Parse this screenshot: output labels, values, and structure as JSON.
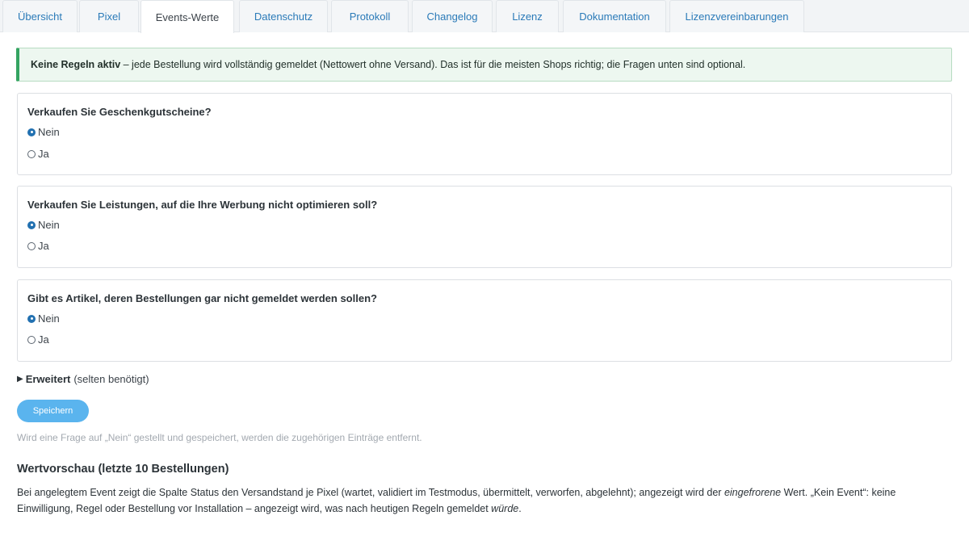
{
  "tabs": [
    {
      "label": "Übersicht",
      "active": false
    },
    {
      "label": "Pixel",
      "active": false
    },
    {
      "label": "Events-Werte",
      "active": true
    },
    {
      "label": "Datenschutz",
      "active": false
    },
    {
      "label": "Protokoll",
      "active": false
    },
    {
      "label": "Changelog",
      "active": false
    },
    {
      "label": "Lizenz",
      "active": false
    },
    {
      "label": "Dokumentation",
      "active": false
    },
    {
      "label": "Lizenzvereinbarungen",
      "active": false
    }
  ],
  "notice": {
    "bold": "Keine Regeln aktiv",
    "text": " – jede Bestellung wird vollständig gemeldet (Nettowert ohne Versand). Das ist für die meisten Shops richtig; die Fragen unten sind optional."
  },
  "questions": [
    {
      "question": "Verkaufen Sie Geschenkgutscheine?",
      "options": [
        "Nein",
        "Ja"
      ],
      "selected": "Nein"
    },
    {
      "question": "Verkaufen Sie Leistungen, auf die Ihre Werbung nicht optimieren soll?",
      "options": [
        "Nein",
        "Ja"
      ],
      "selected": "Nein"
    },
    {
      "question": "Gibt es Artikel, deren Bestellungen gar nicht gemeldet werden sollen?",
      "options": [
        "Nein",
        "Ja"
      ],
      "selected": "Nein"
    }
  ],
  "advanced": {
    "triangle": "▶",
    "label": "Erweitert",
    "note": "(selten benötigt)"
  },
  "save_button": "Speichern",
  "hint": "Wird eine Frage auf „Nein“ gestellt und gespeichert, werden die zugehörigen Einträge entfernt.",
  "preview": {
    "title": "Wertvorschau (letzte 10 Bestellungen)",
    "p1": "Bei angelegtem Event zeigt die Spalte Status den Versandstand je Pixel (wartet, validiert im Testmodus, übermittelt, verworfen, abgelehnt); angezeigt wird der ",
    "p1_em": "eingefrorene",
    "p2": " Wert. „Kein Event“: keine Einwilligung, Regel oder Bestellung vor Installation – angezeigt wird, was nach heutigen Regeln gemeldet ",
    "p2_em": "würde",
    "p3": "."
  },
  "colors": {
    "accent": "#2271b1",
    "tab_link": "#2a7ab8",
    "notice_border": "#34a461",
    "notice_bg": "#edf7f0",
    "save_bg": "#5ab4ee"
  }
}
